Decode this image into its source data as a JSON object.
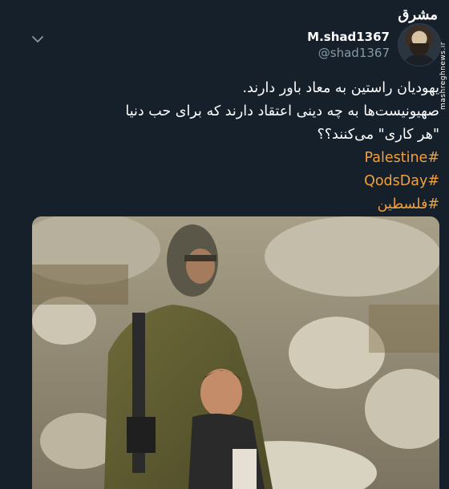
{
  "watermark": {
    "text": "مشرق",
    "url": "mashreghnews.ir"
  },
  "user": {
    "display_name": "M.shad1367",
    "handle": "@shad1367"
  },
  "tweet": {
    "lines": [
      "یهودیان راستین به معاد باور دارند.",
      "صهیونیست‌ها به چه دینی اعتقاد دارند که برای حب دنیا",
      "\"هر کاری\" می‌کنند؟؟"
    ],
    "hashtags": [
      "#Palestine",
      "#QodsDay",
      "#فلسطین"
    ]
  },
  "icons": {
    "menu": "chevron-down-icon",
    "avatar": "avatar-photo"
  },
  "colors": {
    "background": "#15202b",
    "hashtag": "#f2a03d",
    "text": "#ffffff",
    "muted": "#8899a6"
  }
}
